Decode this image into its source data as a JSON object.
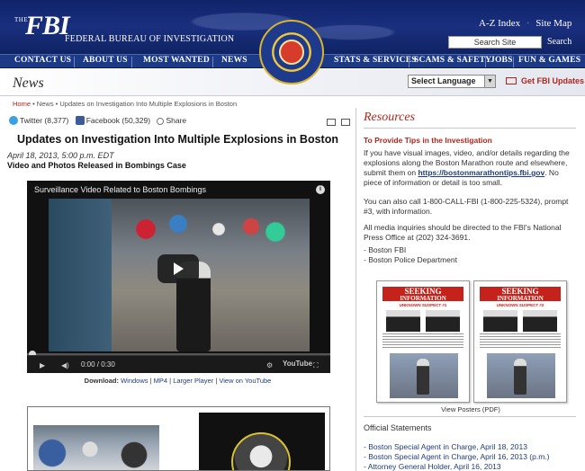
{
  "header": {
    "logo_the": "THE",
    "logo_fbi": "FBI",
    "logo_bureau": "FEDERAL BUREAU OF INVESTIGATION",
    "az_index": "A-Z Index",
    "site_map": "Site Map",
    "search_placeholder": "Search Site",
    "search_button": "Search"
  },
  "nav": {
    "items": [
      "CONTACT US",
      "ABOUT US",
      "MOST WANTED",
      "NEWS",
      "STATS & SERVICES",
      "SCAMS & SAFETY",
      "JOBS",
      "FUN & GAMES"
    ]
  },
  "newsbar": {
    "title": "News",
    "language_select": "Select Language",
    "updates_link": "Get FBI Updates"
  },
  "breadcrumb": {
    "home": "Home",
    "rest": " • News • Updates on Investigation Into Multiple Explosions in Boston"
  },
  "share": {
    "twitter": "Twitter (8,377)",
    "facebook": "Facebook (50,329)",
    "share": "Share"
  },
  "article": {
    "title": "Updates on Investigation Into Multiple Explosions in Boston",
    "date": "April 18, 2013, 5:00 p.m. EDT",
    "subtitle": "Video and Photos Released in Bombings Case"
  },
  "video": {
    "title": "Surveillance Video Related to Boston Bombings",
    "time": "0:00 / 0:30",
    "youtube": "YouTube",
    "progress": 0
  },
  "download": {
    "label": "Download:",
    "windows": "Windows",
    "mp4": "MP4",
    "larger": "Larger Player",
    "youtube": "View on YouTube"
  },
  "sidebar": {
    "resources_title": "Resources",
    "tips_title": "To Provide Tips in the Investigation",
    "p1_before": "If you have visual images, video, and/or details regarding the explosions along the Boston Marathon route and elsewhere, submit them on ",
    "p1_link": "https://bostonmarathontips.fbi.gov",
    "p1_after": ". No piece of information or detail is too small.",
    "p2": "You can also call 1-800-CALL-FBI (1-800-225-5324), prompt #3, with information.",
    "p3": "All media inquiries should be directed to the FBI's National Press Office at (202) 324-3691.",
    "contacts": [
      "- Boston FBI",
      "- Boston Police Department"
    ],
    "posters": [
      {
        "line1": "SEEKING",
        "line2": "INFORMATION",
        "sub": "UNKNOWN SUSPECT #1"
      },
      {
        "line1": "SEEKING",
        "line2": "INFORMATION",
        "sub": "UNKNOWN SUSPECT #2"
      }
    ],
    "view_posters": "View Posters (PDF)",
    "official_title": "Official Statements",
    "statements": [
      "- Boston Special Agent in Charge, April 18, 2013",
      "- Boston Special Agent in Charge, April 16, 2013 (p.m.)",
      "- Attorney General Holder, April 16, 2013"
    ]
  },
  "colors": {
    "header_blue": "#10246a",
    "accent_red": "#b2251c",
    "link_blue": "#1f3d7a"
  }
}
